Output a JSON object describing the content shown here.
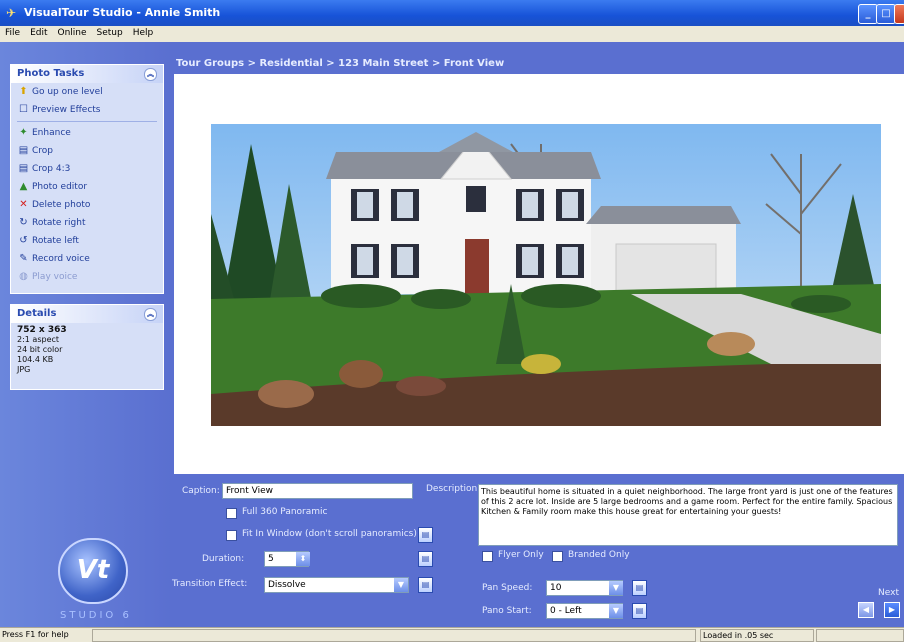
{
  "window": {
    "title": "VisualTour Studio - Annie Smith",
    "min": "_",
    "max": "□",
    "close": "x"
  },
  "menu": [
    "File",
    "Edit",
    "Online",
    "Setup",
    "Help"
  ],
  "photo_tasks": {
    "title": "Photo Tasks",
    "items": [
      {
        "label": "Go up one level",
        "icon": "folder-up-icon",
        "glyph": "⬆"
      },
      {
        "label": "Preview Effects",
        "icon": "checkbox-icon",
        "glyph": "☐"
      },
      {
        "label": "Enhance",
        "icon": "enhance-icon",
        "glyph": "✦"
      },
      {
        "label": "Crop",
        "icon": "crop-icon",
        "glyph": "▤"
      },
      {
        "label": "Crop 4:3",
        "icon": "crop43-icon",
        "glyph": "▤"
      },
      {
        "label": "Photo editor",
        "icon": "photo-editor-icon",
        "glyph": "▲"
      },
      {
        "label": "Delete photo",
        "icon": "delete-icon",
        "glyph": "✕"
      },
      {
        "label": "Rotate right",
        "icon": "rotate-right-icon",
        "glyph": "↻"
      },
      {
        "label": "Rotate left",
        "icon": "rotate-left-icon",
        "glyph": "↺"
      },
      {
        "label": "Record voice",
        "icon": "microphone-icon",
        "glyph": "✎"
      },
      {
        "label": "Play voice",
        "icon": "play-voice-icon",
        "glyph": "◍"
      }
    ]
  },
  "details": {
    "title": "Details",
    "dimensions": "752 x 363",
    "aspect": "2:1 aspect",
    "color": "24 bit color",
    "size": "104.4 KB",
    "format": "JPG"
  },
  "logo": {
    "mark": "Vt",
    "text": "STUDIO 6"
  },
  "breadcrumb": "Tour Groups > Residential > 123 Main Street > Front View",
  "form": {
    "caption_label": "Caption:",
    "caption_value": "Front View",
    "full360_label": "Full 360 Panoramic",
    "fit_label": "Fit In Window (don't scroll panoramics)",
    "duration_label": "Duration:",
    "duration_value": "5",
    "transition_label": "Transition Effect:",
    "transition_value": "Dissolve",
    "description_label": "Description:",
    "description_value": "This beautiful home is situated in a quiet neighborhood. The large front yard is just one of the features of this 2 acre lot. Inside are 5  large  bedrooms and  a game room. Perfect for the entire family. Spacious Kitchen & Family room make this house great for entertaining your guests!",
    "flyer_label": "Flyer Only",
    "branded_label": "Branded Only",
    "pan_speed_label": "Pan Speed:",
    "pan_speed_value": "10",
    "pano_start_label": "Pano Start:",
    "pano_start_value": "0 - Left",
    "next_label": "Next"
  },
  "status": {
    "help": "Press F1 for help",
    "loaded": "Loaded in .05 sec"
  }
}
